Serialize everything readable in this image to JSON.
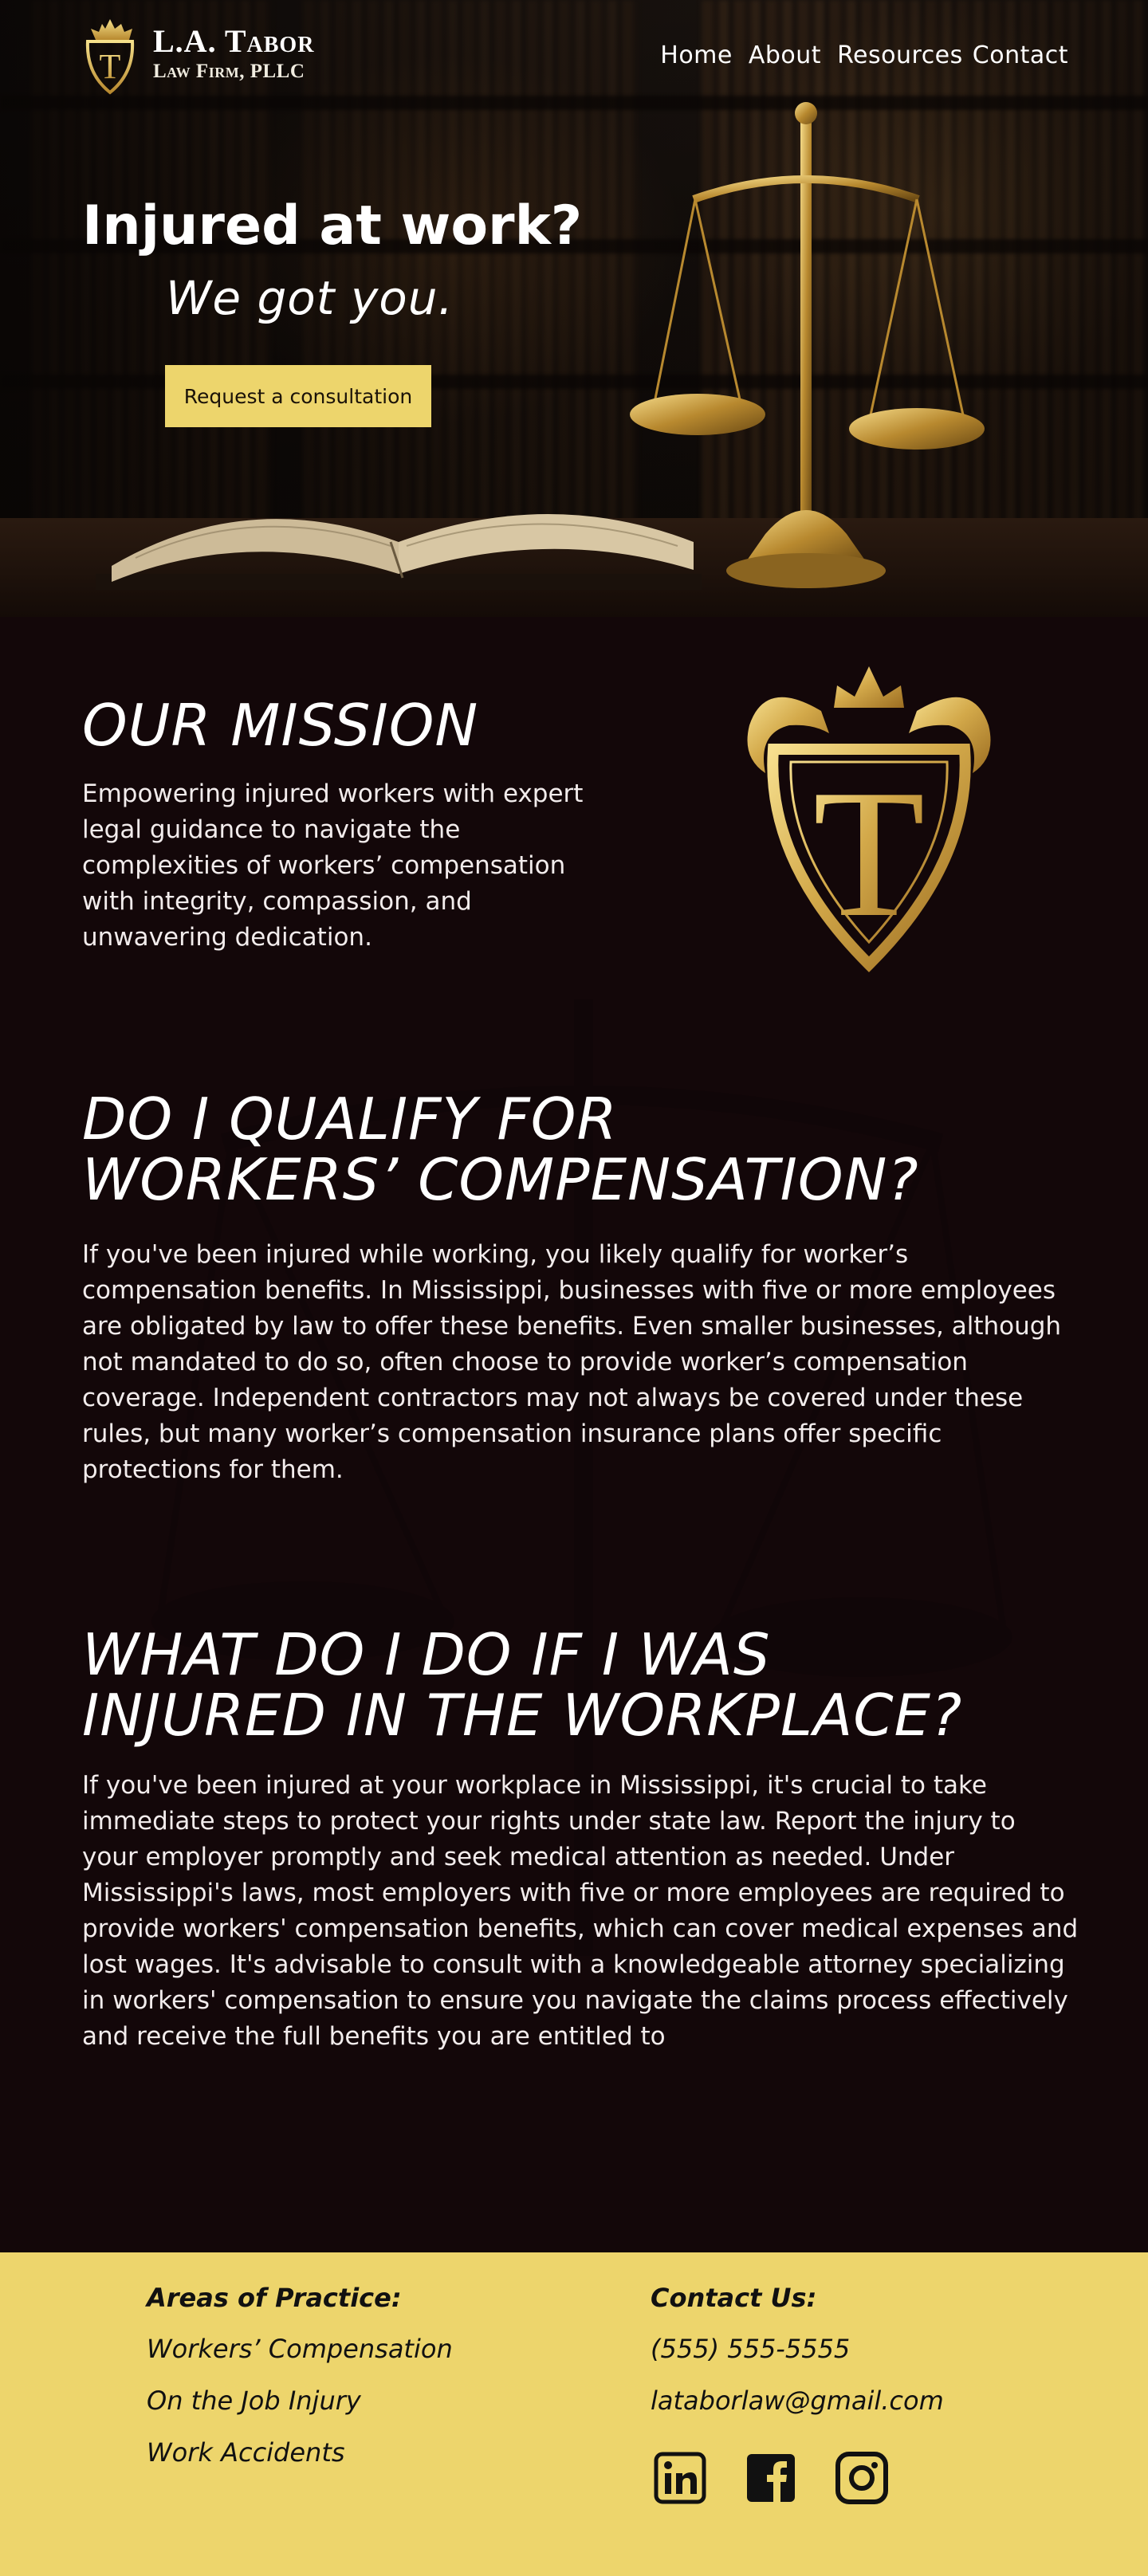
{
  "header": {
    "logo": {
      "name": "L.A. Tabor",
      "sub": "Law Firm, PLLC",
      "mark_letter": "T"
    },
    "nav": [
      "Home",
      "About",
      "Resources",
      "Contact"
    ]
  },
  "hero": {
    "title": "Injured at work?",
    "subtitle": "We got you.",
    "cta_label": "Request a consultation"
  },
  "mission": {
    "title": "OUR MISSION",
    "text": "Empowering injured workers with expert legal guidance to navigate the complexities of workers’ compensation with integrity, compassion, and unwavering dedication.",
    "crest_letter": "T"
  },
  "qualify": {
    "title_line1": "DO I QUALIFY FOR",
    "title_line2": "WORKERS’ COMPENSATION?",
    "text": "If you've been injured while working, you likely qualify for worker’s compensation benefits. In Mississippi, businesses with five or more employees are obligated by law to offer these benefits. Even smaller businesses, although not mandated to do so, often choose to provide worker’s compensation coverage. Independent contractors may not always be covered under these rules, but many worker’s compensation insurance plans offer specific protections for them."
  },
  "injured": {
    "title_line1": "WHAT DO I DO IF I WAS",
    "title_line2": "INJURED IN THE WORKPLACE?",
    "text": "If you've been injured at your workplace in Mississippi, it's crucial to take immediate steps to protect your rights under state law. Report the injury to your employer promptly and seek medical attention as needed. Under Mississippi's laws, most employers with five or more employees are required to provide workers' compensation benefits, which can cover medical expenses and lost wages. It's advisable to consult with a knowledgeable attorney specializing in workers' compensation to ensure you navigate the claims process effectively and receive the full benefits you are entitled to"
  },
  "footer": {
    "practice": {
      "heading": "Areas of Practice:",
      "items": [
        "Workers’ Compensation",
        "On the Job Injury",
        "Work Accidents"
      ]
    },
    "contact": {
      "heading": "Contact Us:",
      "phone": "(555) 555-5555",
      "email": "lataborlaw@gmail.com"
    },
    "socials": [
      "linkedin-icon",
      "facebook-icon",
      "instagram-icon"
    ]
  },
  "colors": {
    "accent_gold": "#edd56c",
    "main_bg": "#130709",
    "text": "#ffffff"
  }
}
